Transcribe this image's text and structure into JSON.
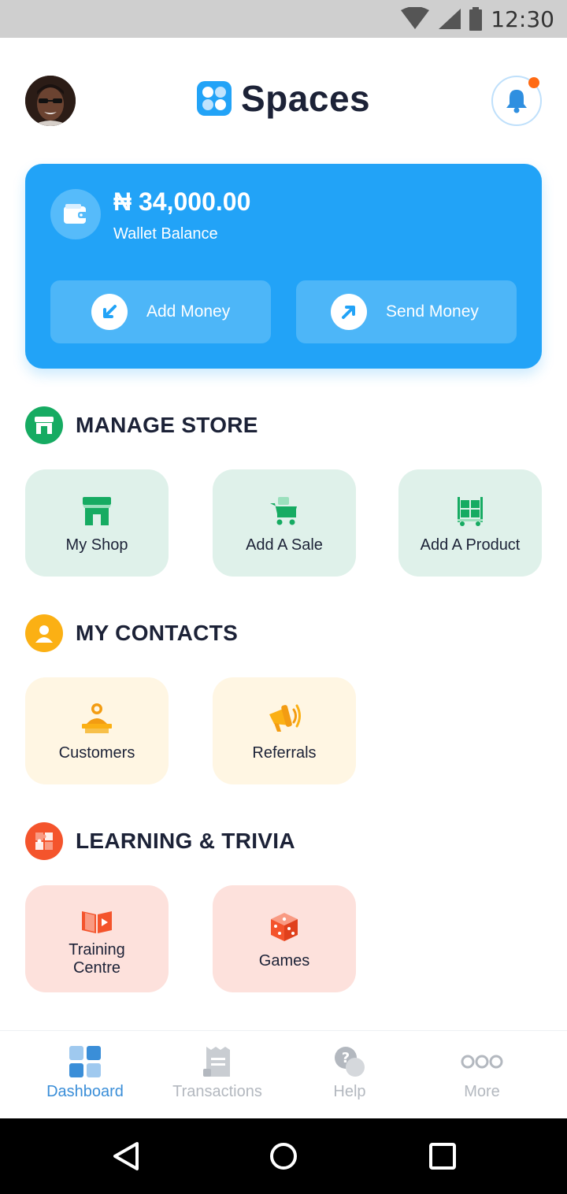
{
  "status_bar": {
    "time": "12:30"
  },
  "header": {
    "app_name": "Spaces",
    "notification_dot_color": "#ff6a13"
  },
  "wallet": {
    "balance": "₦ 34,000.00",
    "label": "Wallet Balance",
    "add_money": "Add Money",
    "send_money": "Send Money",
    "card_color": "#22a3f7"
  },
  "sections": {
    "manage_store": {
      "title": "MANAGE STORE",
      "tiles": [
        {
          "label": "My Shop",
          "icon": "shop-icon"
        },
        {
          "label": "Add A Sale",
          "icon": "cart-icon"
        },
        {
          "label": "Add A Product",
          "icon": "product-trolley-icon"
        }
      ]
    },
    "my_contacts": {
      "title": "MY CONTACTS",
      "tiles": [
        {
          "label": "Customers",
          "icon": "customer-icon"
        },
        {
          "label": "Referrals",
          "icon": "megaphone-icon"
        }
      ]
    },
    "learning": {
      "title": "LEARNING & TRIVIA",
      "tiles": [
        {
          "label": "Training Centre",
          "label_line1": "Training",
          "label_line2": "Centre",
          "icon": "training-book-icon"
        },
        {
          "label": "Games",
          "icon": "dice-icon"
        }
      ]
    }
  },
  "bottom_nav": {
    "items": [
      {
        "label": "Dashboard",
        "icon": "dashboard-icon",
        "active": true
      },
      {
        "label": "Transactions",
        "icon": "receipt-icon",
        "active": false
      },
      {
        "label": "Help",
        "icon": "help-chat-icon",
        "active": false
      },
      {
        "label": "More",
        "icon": "more-dots-icon",
        "active": false
      }
    ],
    "active_color": "#3a8ed8"
  }
}
